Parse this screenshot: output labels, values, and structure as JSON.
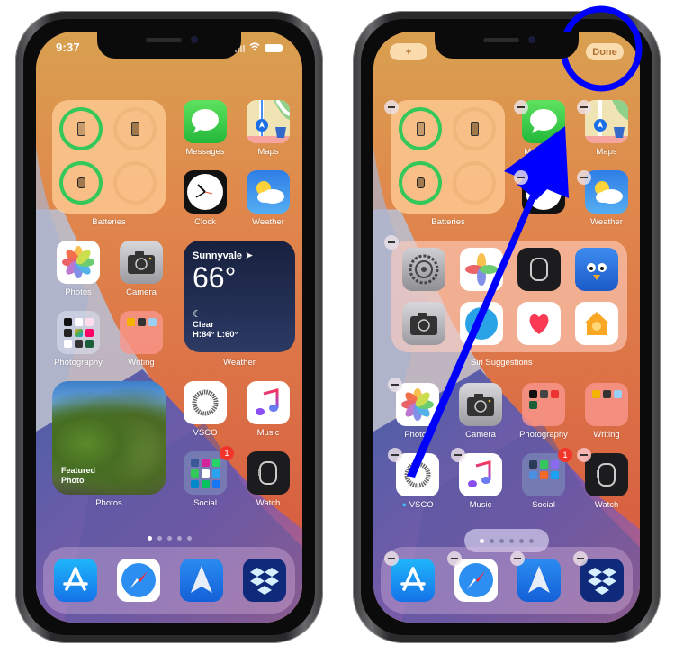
{
  "left_phone": {
    "status": {
      "time": "9:37"
    },
    "widgets": {
      "batteries": {
        "label": "Batteries"
      },
      "weather": {
        "city": "Sunnyvale",
        "temp": "66°",
        "condition": "Clear",
        "high_low": "H:84° L:60°",
        "label": "Weather"
      },
      "photos": {
        "overlay_line1": "Featured",
        "overlay_line2": "Photo",
        "label": "Photos"
      }
    },
    "apps": [
      {
        "name": "Messages"
      },
      {
        "name": "Maps"
      },
      {
        "name": "Clock"
      },
      {
        "name": "Weather"
      },
      {
        "name": "Photos"
      },
      {
        "name": "Camera"
      },
      {
        "name": "Photography"
      },
      {
        "name": "Writing"
      },
      {
        "name": "VSCO"
      },
      {
        "name": "Music"
      },
      {
        "name": "Social",
        "badge": "1"
      },
      {
        "name": "Watch"
      }
    ],
    "page_dots": {
      "count": 5,
      "active": 1
    },
    "dock": [
      "App Store",
      "Safari",
      "Spark",
      "Dropbox"
    ]
  },
  "right_phone": {
    "edit_mode": true,
    "add_button": "+",
    "done_button": "Done",
    "widgets": {
      "batteries": {
        "label": "Batteries"
      },
      "siri": {
        "label": "Siri Suggestions"
      }
    },
    "apps": [
      {
        "name": "Messages"
      },
      {
        "name": "Maps"
      },
      {
        "name": "Clock"
      },
      {
        "name": "Weather"
      },
      {
        "name": "Photos"
      },
      {
        "name": "Camera"
      },
      {
        "name": "Photography"
      },
      {
        "name": "Writing"
      },
      {
        "name": "VSCO"
      },
      {
        "name": "Music"
      },
      {
        "name": "Social",
        "badge": "1"
      },
      {
        "name": "Watch"
      }
    ],
    "siri_suggestions": [
      "Settings",
      "Photos",
      "Watch",
      "Tweetbot",
      "Camera",
      "Telegram",
      "Health",
      "Home"
    ],
    "page_dots": {
      "count": 6,
      "active": 1
    },
    "dock": [
      "App Store",
      "Safari",
      "Spark",
      "Dropbox"
    ]
  },
  "annotation": {
    "color": "#0000ff",
    "circle_target": "Done",
    "arrow_description": "arrow pointing from VSCO toward the Done button"
  }
}
